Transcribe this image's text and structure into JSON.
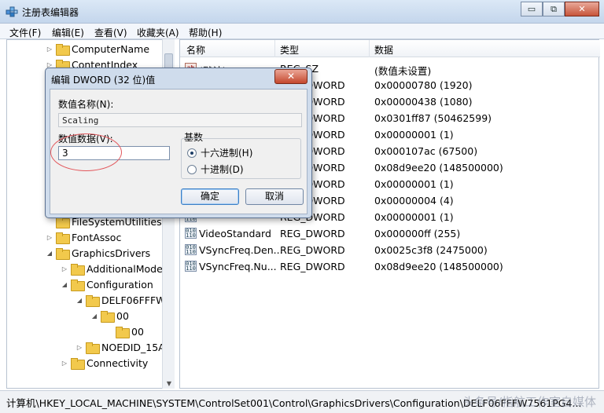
{
  "window": {
    "title": "注册表编辑器",
    "controls": {
      "minimize": "▭",
      "restore": "⧉",
      "close": "✕"
    }
  },
  "menu": [
    "文件(F)",
    "编辑(E)",
    "查看(V)",
    "收藏夹(A)",
    "帮助(H)"
  ],
  "tree": [
    {
      "label": "ComputerName",
      "indent": 0,
      "state": "collapsed"
    },
    {
      "label": "ContentIndex",
      "indent": 0,
      "state": "collapsed"
    },
    {
      "label": "FileSystemUtilities",
      "indent": 0,
      "state": "none"
    },
    {
      "label": "FontAssoc",
      "indent": 0,
      "state": "collapsed"
    },
    {
      "label": "GraphicsDrivers",
      "indent": 0,
      "state": "expanded"
    },
    {
      "label": "AdditionalMode",
      "indent": 1,
      "state": "collapsed"
    },
    {
      "label": "Configuration",
      "indent": 1,
      "state": "expanded"
    },
    {
      "label": "DELF06FFFW",
      "indent": 2,
      "state": "expanded"
    },
    {
      "label": "00",
      "indent": 3,
      "state": "expanded"
    },
    {
      "label": "00",
      "indent": 4,
      "state": "none",
      "selected": true
    },
    {
      "label": "NOEDID_15A",
      "indent": 2,
      "state": "collapsed"
    },
    {
      "label": "Connectivity",
      "indent": 1,
      "state": "collapsed"
    }
  ],
  "list": {
    "columns": [
      "名称",
      "类型",
      "数据"
    ],
    "rows": [
      {
        "name": "(默认)",
        "type": "REG_SZ",
        "data": "(数值未设置)",
        "icon": "sz"
      },
      {
        "name": "",
        "type": "REG_DWORD",
        "data": "0x00000780 (1920)",
        "icon": "dword"
      },
      {
        "name": "",
        "type": "REG_DWORD",
        "data": "0x00000438 (1080)",
        "icon": "dword"
      },
      {
        "name": "",
        "type": "REG_DWORD",
        "data": "0x0301ff87 (50462599)",
        "icon": "dword"
      },
      {
        "name": "",
        "type": "REG_DWORD",
        "data": "0x00000001 (1)",
        "icon": "dword"
      },
      {
        "name": "",
        "type": "REG_DWORD",
        "data": "0x000107ac (67500)",
        "icon": "dword"
      },
      {
        "name": "",
        "type": "REG_DWORD",
        "data": "0x08d9ee20 (148500000)",
        "icon": "dword"
      },
      {
        "name": "",
        "type": "REG_DWORD",
        "data": "0x00000001 (1)",
        "icon": "dword"
      },
      {
        "name": "",
        "type": "REG_DWORD",
        "data": "0x00000004 (4)",
        "icon": "dword"
      },
      {
        "name": "",
        "type": "REG_DWORD",
        "data": "0x00000001 (1)",
        "icon": "dword"
      },
      {
        "name": "VideoStandard",
        "type": "REG_DWORD",
        "data": "0x000000ff (255)",
        "icon": "dword"
      },
      {
        "name": "VSyncFreq.Den...",
        "type": "REG_DWORD",
        "data": "0x0025c3f8 (2475000)",
        "icon": "dword"
      },
      {
        "name": "VSyncFreq.Nu...",
        "type": "REG_DWORD",
        "data": "0x08d9ee20 (148500000)",
        "icon": "dword"
      }
    ]
  },
  "dialog": {
    "title": "编辑 DWORD (32 位)值",
    "close": "✕",
    "name_label": "数值名称(N):",
    "name_value": "Scaling",
    "data_label": "数值数据(V):",
    "data_value": "3",
    "base_label": "基数",
    "radios": [
      {
        "label": "十六进制(H)",
        "checked": true
      },
      {
        "label": "十进制(D)",
        "checked": false
      }
    ],
    "ok": "确定",
    "cancel": "取消"
  },
  "status": {
    "path": "计算机\\HKEY_LOCAL_MACHINE\\SYSTEM\\ControlSet001\\Control\\GraphicsDrivers\\Configuration\\DELF06FFFW7561PG4...",
    "watermark": "头条号/指航工作室自媒体"
  }
}
